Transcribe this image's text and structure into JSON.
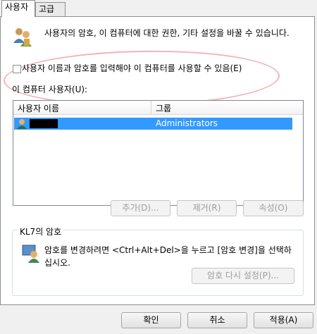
{
  "tabs": [
    "사용자",
    "고급"
  ],
  "description": "사용자의 암호, 이 컴퓨터에 대한  권한, 기타 설정을 바꿀 수 있습니다.",
  "must_enter_label": "사용자 이름과 암호를 입력해야 이 컴퓨터를 사용할 수 있음(E)",
  "users_label": "이 컴퓨터 사용자(U):",
  "columns": [
    "사용자 이름",
    "그룹"
  ],
  "rows": [
    {
      "group": "Administrators"
    }
  ],
  "buttons": {
    "add": "추가(D)...",
    "remove": "제거(R)",
    "properties": "속성(O)"
  },
  "password_group": {
    "title": "KL7의 암호",
    "text": "암호를 변경하려면 <Ctrl+Alt+Del>을 누르고 [암호 변경]을 선택하십시오.",
    "reset": "암호 다시 설정(P)..."
  },
  "footer": {
    "ok": "확인",
    "cancel": "취소",
    "apply": "적용(A)"
  }
}
